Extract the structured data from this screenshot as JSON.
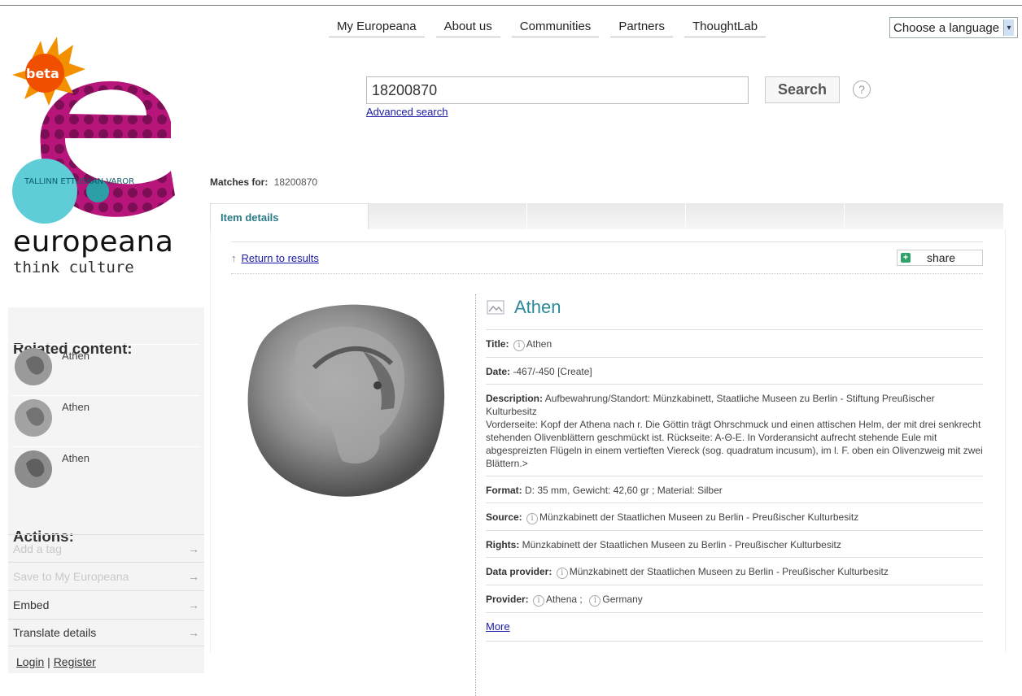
{
  "nav": {
    "items": [
      "My Europeana",
      "About us",
      "Communities",
      "Partners",
      "ThoughtLab"
    ],
    "language": "Choose a language"
  },
  "logo": {
    "badge": "beta",
    "brand": "europeana",
    "tagline": "think culture",
    "poster_text": "TALLINN ETTUSKAN VAROR"
  },
  "search": {
    "value": "18200870",
    "button": "Search",
    "help": "?",
    "advanced": "Advanced search"
  },
  "matches": {
    "label": "Matches for:",
    "query": "18200870"
  },
  "tabs": {
    "active": "Item details"
  },
  "toolbar": {
    "return": "Return to results",
    "share": "share"
  },
  "item": {
    "title": "Athen",
    "fields": [
      {
        "label": "Title:",
        "info": true,
        "value": "Athen"
      },
      {
        "label": "Date:",
        "info": false,
        "value": "-467/-450 [Create]"
      },
      {
        "label": "Description:",
        "info": false,
        "value": "Aufbewahrung/Standort: Münzkabinett, Staatliche Museen zu Berlin - Stiftung Preußischer Kulturbesitz",
        "value2": "Vorderseite: Kopf der Athena nach r. Die Göttin trägt Ohrschmuck und einen attischen Helm, der mit drei senkrecht stehenden Olivenblättern geschmückt ist. Rückseite: A-Θ-E. In Vorderansicht aufrecht stehende Eule mit abgespreizten Flügeln in einem vertieften Viereck (sog. quadratum incusum), im l. F. oben ein Olivenzweig mit zwei Blättern.>"
      },
      {
        "label": "Format:",
        "info": false,
        "value": "D: 35 mm, Gewicht: 42,60 gr ;  Material: Silber"
      },
      {
        "label": "Source:",
        "info": true,
        "value": "Münzkabinett der Staatlichen Museen zu Berlin - Preußischer Kulturbesitz"
      },
      {
        "label": "Rights:",
        "info": false,
        "value": "Münzkabinett der Staatlichen Museen zu Berlin - Preußischer Kulturbesitz"
      },
      {
        "label": "Data provider:",
        "info": true,
        "value": "Münzkabinett der Staatlichen Museen zu Berlin - Preußischer Kulturbesitz"
      },
      {
        "label": "Provider:",
        "info": true,
        "value": "Athena ;",
        "value_b": "Germany"
      }
    ],
    "more": "More"
  },
  "sidebar": {
    "related_title": "Related content:",
    "related": [
      "Athen",
      "Athen",
      "Athen"
    ],
    "actions_title": "Actions:",
    "actions": [
      {
        "label": "Add a tag",
        "disabled": true
      },
      {
        "label": "Save to My Europeana",
        "disabled": true
      },
      {
        "label": "Embed",
        "disabled": false
      },
      {
        "label": "Translate details",
        "disabled": false
      }
    ],
    "login": "Login",
    "sep": "|",
    "register": "Register"
  }
}
